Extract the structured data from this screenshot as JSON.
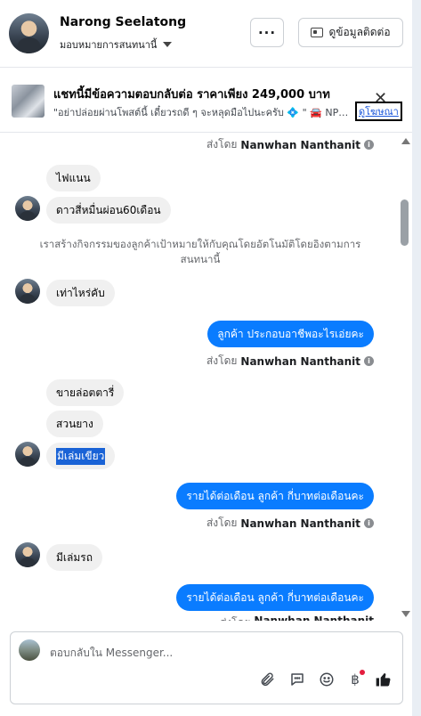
{
  "header": {
    "name": "Narong Seelatong",
    "assign_label": "มอบหมายการสนทนานี้",
    "more_label": "···",
    "contact_label": "ดูข้อมูลติดต่อ"
  },
  "ad": {
    "title": "แชทนี้มีข้อความตอบกลับต่อ ราคาเพียง 249,000 บาท",
    "subtitle": "\"อย่าปล่อยผ่านโพสต์นี้ เดี๋ยวรถดี ๆ จะหลุดมือไปนะครับ 💠 \" 🚘 NP300 N...",
    "link": "ดูโฆษณา",
    "close": "✕"
  },
  "messages": {
    "sent_by_prefix": "ส่งโดย",
    "sender": "Nanwhan Nanthanit",
    "m1": "ไฟแนน",
    "m2": "ดาวสี่หมื่นผ่อน60เดือน",
    "system": "เราสร้างกิจกรรมของลูกค้าเป้าหมายให้กับคุณโดยอัตโนมัติโดยอิงตามการสนทนานี้",
    "m3": "เท่าไหร่คับ",
    "m4": "ลูกค้า ประกอบอาชีพอะไรเอ่ยคะ",
    "m5": "ขายล่อตตารี่",
    "m6": "สวนยาง",
    "m7": "มีเล่มเขียว",
    "m8": "รายได้ต่อเดือน ลูกค้า  กี่บาทต่อเดือนคะ",
    "m9": "มีเล่มรถ",
    "m10": "รายได้ต่อเดือน ลูกค้า  กี่บาทต่อเดือนคะ"
  },
  "composer": {
    "placeholder": "ตอบกลับใน Messenger...",
    "baht_symbol": "฿"
  }
}
